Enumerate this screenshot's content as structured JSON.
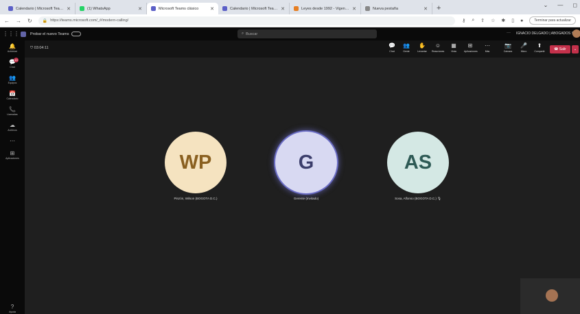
{
  "browser": {
    "tabs": [
      {
        "label": "Calendario | Microsoft Teams cl…",
        "color": "#5b5fc7"
      },
      {
        "label": "(1) WhatsApp",
        "color": "#25d366"
      },
      {
        "label": "Microsoft Teams clásico",
        "color": "#5b5fc7"
      },
      {
        "label": "Calendario | Microsoft Teams cl…",
        "color": "#5b5fc7"
      },
      {
        "label": "Leyes desde 1992 - Vigencia ex…",
        "color": "#e67e22"
      },
      {
        "label": "Nueva pestaña",
        "color": "#888888"
      }
    ],
    "url": "https://teams.microsoft.com/_#/modern-calling/",
    "finish_update": "Terminar para actualizar"
  },
  "teams": {
    "new_teams_label": "Probar el nuevo Teams",
    "search_placeholder": "Buscar",
    "user_name": "IGNACIO DELGADO | ABOGADOS SAS",
    "rail": [
      {
        "icon": "🔔",
        "label": "Actividad"
      },
      {
        "icon": "💬",
        "label": "Chat",
        "badge": "10"
      },
      {
        "icon": "👥",
        "label": "Equipos"
      },
      {
        "icon": "📅",
        "label": "Calendario"
      },
      {
        "icon": "📞",
        "label": "Llamadas"
      },
      {
        "icon": "☁",
        "label": "Archivos"
      },
      {
        "icon": "⋯",
        "label": ""
      },
      {
        "icon": "⊞",
        "label": "Aplicaciones"
      }
    ],
    "help_label": "Ayuda"
  },
  "meeting": {
    "timer": "03:04:11",
    "controls": [
      {
        "icon": "💬",
        "label": "Chat"
      },
      {
        "icon": "👥",
        "label": "Gente"
      },
      {
        "icon": "✋",
        "label": "Levantar"
      },
      {
        "icon": "☺",
        "label": "Reacciones"
      },
      {
        "icon": "▦",
        "label": "Vista"
      },
      {
        "icon": "⊞",
        "label": "Aplicaciones"
      },
      {
        "icon": "⋯",
        "label": "Más"
      }
    ],
    "media": [
      {
        "icon": "📷",
        "label": "Cámara"
      },
      {
        "icon": "🎤",
        "label": "Micro"
      },
      {
        "icon": "⬆",
        "label": "Compartir"
      }
    ],
    "leave_label": "Salir",
    "participants": [
      {
        "initials": "WP",
        "name": "Pinzón, Wilson (BOGOTA D.C.)",
        "bg": "#f5e3c0",
        "fg": "#8a6020"
      },
      {
        "initials": "G",
        "name": "Gerente (Invitado)",
        "bg": "#d8d9f2",
        "fg": "#3b3d6b"
      },
      {
        "initials": "AS",
        "name": "Sosa, Alfonso (BOGOTA D.C.)  🎙",
        "bg": "#d4e8e4",
        "fg": "#2e5a55"
      }
    ]
  }
}
